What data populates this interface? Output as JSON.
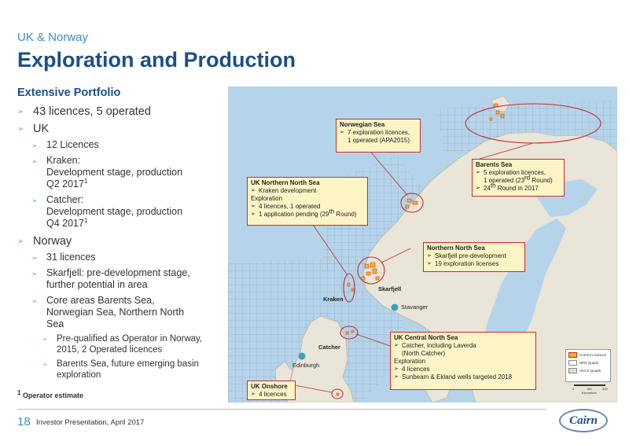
{
  "header": {
    "pre_title": "UK & Norway",
    "title": "Exploration and Production"
  },
  "portfolio": {
    "heading": "Extensive Portfolio",
    "bullet_licences": "43 licences, 5 operated",
    "uk_label": "UK",
    "uk_licences": "12 Licences",
    "kraken_line1": "Kraken:",
    "kraken_line2": "Development stage, production",
    "kraken_line3": "Q2 2017",
    "catcher_line1": "Catcher:",
    "catcher_line2": "Development stage, production",
    "catcher_line3": "Q4 2017",
    "superscript": "1",
    "norway_label": "Norway",
    "norway_licences": "31 licences",
    "skarfjell_line1": "Skarfjell: pre-development stage,",
    "skarfjell_line2": "further potential in area",
    "core_line1": "Core areas Barents Sea,",
    "core_line2": "Norwegian Sea, Northern North",
    "core_line3": "Sea",
    "prequal_line1": "Pre-qualified as Operator in Norway,",
    "prequal_line2": "2015, 2 Operated licences",
    "barents_line1": "Barents Sea, future emerging basin",
    "barents_line2": "exploration"
  },
  "footnote": {
    "sup": "1",
    "text": " Operator estimate"
  },
  "footer": {
    "page_number": "18",
    "text": "Investor Presentation, April 2017",
    "logo_text": "Cairn"
  },
  "map": {
    "callouts": {
      "norwegian_sea": {
        "title": "Norwegian Sea",
        "item1_line1": "7 exploration licences,",
        "item1_line2": "1 operated (APA2015)"
      },
      "barents_sea": {
        "title": "Barents Sea",
        "item1_line1": "5 exploration licences,",
        "item1_line2a": "1 operated (23",
        "item1_sup": "rd",
        "item1_line2b": " Round)",
        "item2a": "24",
        "item2_sup": "th",
        "item2b": " Round in 2017"
      },
      "uk_northern": {
        "title": "UK Northern North Sea",
        "item1": "Kraken development",
        "sub": "Exploration",
        "item2": "4 licences, 1 operated",
        "item3a": "1 application pending (29",
        "item3_sup": "th",
        "item3b": " Round)"
      },
      "northern_north": {
        "title": "Northern North Sea",
        "item1": "Skarfjell pre-development",
        "item2": "19 exploration licenses"
      },
      "uk_central": {
        "title": "UK Central North Sea",
        "item1_line1": "Catcher, including Laverda",
        "item1_line2": "(North Catcher)",
        "sub": "Exploration",
        "item2": "4 licences",
        "item3": "Sunbeam & Ekland wells targeted 2018"
      },
      "uk_onshore": {
        "title": "UK Onshore",
        "item1": "4 licences"
      }
    },
    "places": {
      "kraken": "Kraken",
      "skarfjell": "Skarfjell",
      "stavanger": "Stavanger",
      "catcher": "Catcher",
      "edinburgh": "Edinburgh"
    },
    "legend": {
      "item1": "Current Licences",
      "item2": "NPD Quads",
      "item3": "UKCS Quads"
    },
    "scale": {
      "label0": "0",
      "label1": "150",
      "label2": "300",
      "unit": "Kilometres"
    },
    "colors": {
      "sea": "#b5d4ea",
      "land": "#e9e5d8",
      "licence": "#f2b619",
      "callout_border": "#c62b2b",
      "callout_fill": "#fdf4c6"
    }
  }
}
